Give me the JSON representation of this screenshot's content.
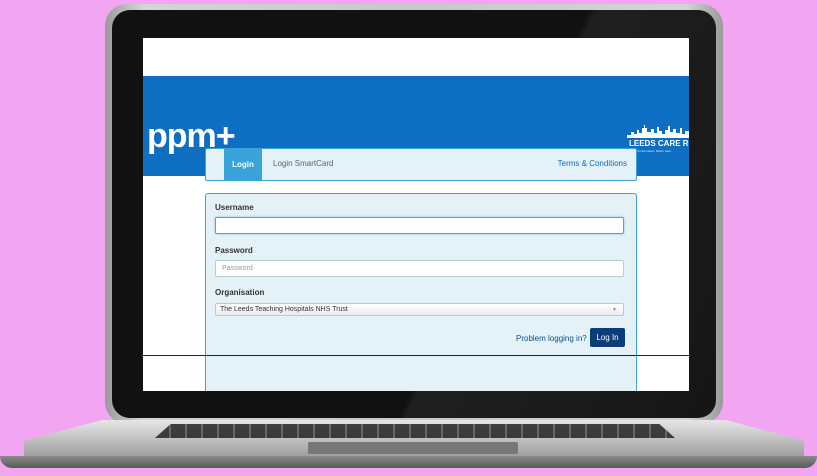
{
  "header": {
    "logo": "ppm+",
    "partner_logo": "LEEDS CARE REC",
    "partner_tagline": "Shared information. Better care."
  },
  "tabs": [
    {
      "label": "Login",
      "active": true
    },
    {
      "label": "Login SmartCard",
      "active": false
    }
  ],
  "terms_link": "Terms & Conditions",
  "form": {
    "username_label": "Username",
    "username_value": "",
    "password_label": "Password",
    "password_placeholder": "Password",
    "organisation_label": "Organisation",
    "organisation_value": "The Leeds Teaching Hospitals NHS Trust",
    "problem_link": "Problem logging in?",
    "submit_label": "Log In"
  },
  "colors": {
    "background": "#f2a6f2",
    "header_blue": "#0e6ec2",
    "tab_active": "#3aa3d9",
    "button": "#0a3d7a"
  }
}
